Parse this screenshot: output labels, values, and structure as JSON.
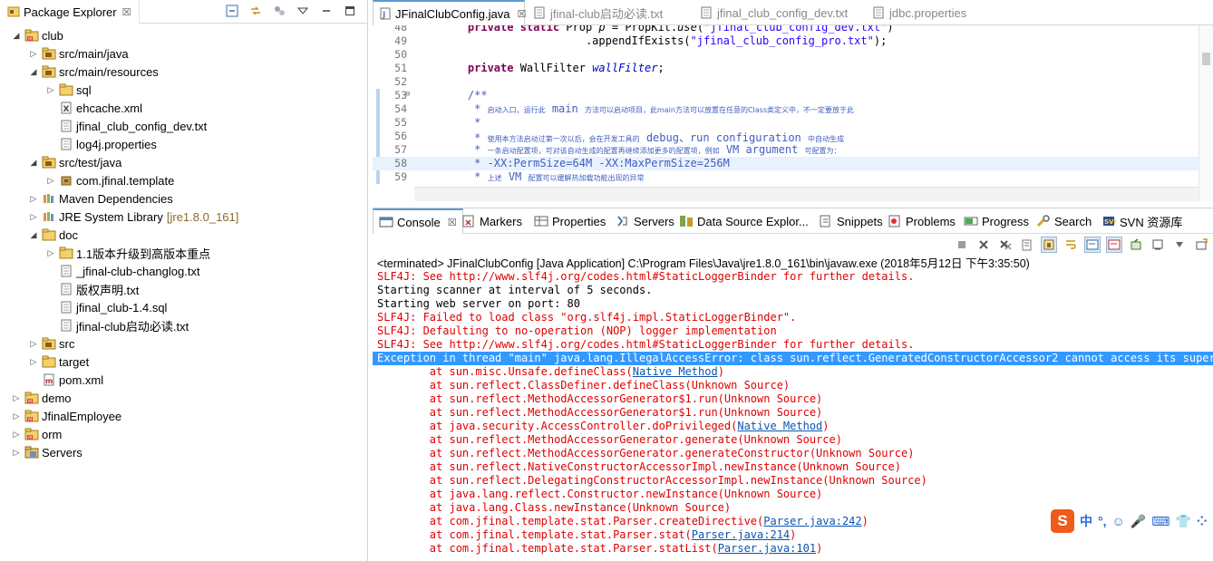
{
  "package_explorer": {
    "tab_label": "Package Explorer",
    "tree": [
      {
        "depth": 0,
        "expanded": true,
        "icon": "project-icon",
        "label": "club"
      },
      {
        "depth": 1,
        "expanded": false,
        "icon": "source-folder-icon",
        "label": "src/main/java"
      },
      {
        "depth": 1,
        "expanded": true,
        "icon": "source-folder-icon",
        "label": "src/main/resources"
      },
      {
        "depth": 2,
        "expanded": false,
        "icon": "folder-icon",
        "label": "sql"
      },
      {
        "depth": 2,
        "leaf": true,
        "icon": "xml-file-icon",
        "label": "ehcache.xml"
      },
      {
        "depth": 2,
        "leaf": true,
        "icon": "text-file-icon",
        "label": "jfinal_club_config_dev.txt"
      },
      {
        "depth": 2,
        "leaf": true,
        "icon": "text-file-icon",
        "label": "log4j.properties"
      },
      {
        "depth": 1,
        "expanded": true,
        "icon": "source-folder-icon",
        "label": "src/test/java"
      },
      {
        "depth": 2,
        "expanded": false,
        "icon": "package-icon",
        "label": "com.jfinal.template"
      },
      {
        "depth": 1,
        "expanded": false,
        "icon": "library-icon",
        "label": "Maven Dependencies"
      },
      {
        "depth": 1,
        "expanded": false,
        "icon": "library-icon",
        "label": "JRE System Library",
        "decoration": "[jre1.8.0_161]"
      },
      {
        "depth": 1,
        "expanded": true,
        "icon": "folder-icon",
        "label": "doc"
      },
      {
        "depth": 2,
        "expanded": false,
        "icon": "folder-icon",
        "label": "1.1版本升级到高版本重点"
      },
      {
        "depth": 2,
        "leaf": true,
        "icon": "text-file-icon",
        "label": "_jfinal-club-changlog.txt"
      },
      {
        "depth": 2,
        "leaf": true,
        "icon": "text-file-icon",
        "label": "版权声明.txt"
      },
      {
        "depth": 2,
        "leaf": true,
        "icon": "text-file-icon",
        "label": "jfinal_club-1.4.sql"
      },
      {
        "depth": 2,
        "leaf": true,
        "icon": "text-file-icon",
        "label": "jfinal-club启动必读.txt"
      },
      {
        "depth": 1,
        "expanded": false,
        "icon": "source-folder-icon",
        "label": "src"
      },
      {
        "depth": 1,
        "expanded": false,
        "icon": "folder-icon",
        "label": "target"
      },
      {
        "depth": 1,
        "leaf": true,
        "icon": "maven-file-icon",
        "label": "pom.xml"
      },
      {
        "depth": 0,
        "expanded": false,
        "icon": "project-icon",
        "label": "demo"
      },
      {
        "depth": 0,
        "expanded": false,
        "icon": "project-icon",
        "label": "JfinalEmployee"
      },
      {
        "depth": 0,
        "expanded": false,
        "icon": "project-icon",
        "label": "orm"
      },
      {
        "depth": 0,
        "expanded": false,
        "icon": "servers-folder-icon",
        "label": "Servers"
      }
    ]
  },
  "editor": {
    "tabs": [
      {
        "label": "JFinalClubConfig.java",
        "active": true,
        "icon": "java-file-icon"
      },
      {
        "label": "jfinal-club启动必读.txt",
        "active": false,
        "icon": "text-file-icon"
      },
      {
        "label": "jfinal_club_config_dev.txt",
        "active": false,
        "icon": "text-file-icon"
      },
      {
        "label": "jdbc.properties",
        "active": false,
        "icon": "text-file-icon"
      }
    ],
    "lines": [
      {
        "n": "48",
        "html": "    <span class=\"kw\">private static</span> Prop <i>p</i> = PropKit.<i>use</i>(<span class=\"str\">\"jfinal_club_config_dev.txt\"</span>)"
      },
      {
        "n": "49",
        "html": "                      .appendIfExists(<span class=\"str\">\"jfinal_club_config_pro.txt\"</span>);"
      },
      {
        "n": "50",
        "html": ""
      },
      {
        "n": "51",
        "html": "    <span class=\"kw\">private</span> WallFilter <span class=\"fld\">wallFilter</span>;"
      },
      {
        "n": "52",
        "html": ""
      },
      {
        "n": "53",
        "fold": true,
        "html": "    <span class=\"jd\">/**</span>"
      },
      {
        "n": "54",
        "html": "     <span class=\"jd\">*</span> <span class=\"jdsm\">启动入口，运行此</span> <span class=\"jd\">main</span> <span class=\"jdsm\">方法可以启动项目，此main方法可以放置在任意的Class类定义中，不一定要放于此</span>"
      },
      {
        "n": "55",
        "html": "     <span class=\"jd\">*</span>"
      },
      {
        "n": "56",
        "html": "     <span class=\"jd\">*</span> <span class=\"jdsm\">使用本方法启动过第一次以后，会在开发工具的</span> <span class=\"jd\">debug、run configuration</span> <span class=\"jdsm\">中自动生成</span>"
      },
      {
        "n": "57",
        "html": "     <span class=\"jd\">*</span> <span class=\"jdsm\">一条启动配置项，可对该自动生成的配置再继续添加更多的配置项，例如</span> <span class=\"jd\">VM argument</span> <span class=\"jdsm\">可配置为：</span>"
      },
      {
        "n": "58",
        "hl": true,
        "html": "     <span class=\"jd\">* -XX:PermSize=64M -XX:MaxPermSize=256M</span>"
      },
      {
        "n": "59",
        "html": "     <span class=\"jd\">*</span> <span class=\"jdsm\">上述</span> <span class=\"jd\">VM</span> <span class=\"jdsm\">配置可以缓解热加载功能出现的异常</span>"
      }
    ]
  },
  "console": {
    "tabs": [
      {
        "label": "Console",
        "icon": "console-icon",
        "active": true
      },
      {
        "label": "Markers",
        "icon": "markers-icon"
      },
      {
        "label": "Properties",
        "icon": "properties-icon"
      },
      {
        "label": "Servers",
        "icon": "servers-icon"
      },
      {
        "label": "Data Source Explor...",
        "icon": "data-source-icon"
      },
      {
        "label": "Snippets",
        "icon": "snippets-icon"
      },
      {
        "label": "Problems",
        "icon": "problems-icon"
      },
      {
        "label": "Progress",
        "icon": "progress-icon"
      },
      {
        "label": "Search",
        "icon": "search-icon"
      },
      {
        "label": "SVN 资源库",
        "icon": "svn-icon"
      }
    ],
    "terminated_line": "<terminated> JFinalClubConfig [Java Application] C:\\Program Files\\Java\\jre1.8.0_161\\bin\\javaw.exe (2018年5月12日 下午3:35:50)",
    "lines": [
      {
        "t": "err",
        "text": "SLF4J: See http://www.slf4j.org/codes.html#StaticLoggerBinder for further details."
      },
      {
        "t": "std",
        "text": "Starting scanner at interval of 5 seconds."
      },
      {
        "t": "std",
        "text": "Starting web server on port: 80"
      },
      {
        "t": "err",
        "text": "SLF4J: Failed to load class \"org.slf4j.impl.StaticLoggerBinder\"."
      },
      {
        "t": "err",
        "text": "SLF4J: Defaulting to no-operation (NOP) logger implementation"
      },
      {
        "t": "err",
        "text": "SLF4J: See http://www.slf4j.org/codes.html#StaticLoggerBinder for further details."
      },
      {
        "t": "sel",
        "text": "Exception in thread \"main\" java.lang.IllegalAccessError: class sun.reflect.GeneratedConstructorAccessor2 cannot access its superclass"
      },
      {
        "t": "err",
        "text": "\tat sun.misc.Unsafe.defineClass(",
        "link": "Native Method",
        "after": ")"
      },
      {
        "t": "err",
        "text": "\tat sun.reflect.ClassDefiner.defineClass(Unknown Source)"
      },
      {
        "t": "err",
        "text": "\tat sun.reflect.MethodAccessorGenerator$1.run(Unknown Source)"
      },
      {
        "t": "err",
        "text": "\tat sun.reflect.MethodAccessorGenerator$1.run(Unknown Source)"
      },
      {
        "t": "err",
        "text": "\tat java.security.AccessController.doPrivileged(",
        "link": "Native Method",
        "after": ")"
      },
      {
        "t": "err",
        "text": "\tat sun.reflect.MethodAccessorGenerator.generate(Unknown Source)"
      },
      {
        "t": "err",
        "text": "\tat sun.reflect.MethodAccessorGenerator.generateConstructor(Unknown Source)"
      },
      {
        "t": "err",
        "text": "\tat sun.reflect.NativeConstructorAccessorImpl.newInstance(Unknown Source)"
      },
      {
        "t": "err",
        "text": "\tat sun.reflect.DelegatingConstructorAccessorImpl.newInstance(Unknown Source)"
      },
      {
        "t": "err",
        "text": "\tat java.lang.reflect.Constructor.newInstance(Unknown Source)"
      },
      {
        "t": "err",
        "text": "\tat java.lang.Class.newInstance(Unknown Source)"
      },
      {
        "t": "err",
        "text": "\tat com.jfinal.template.stat.Parser.createDirective(",
        "link": "Parser.java:242",
        "after": ")"
      },
      {
        "t": "err",
        "text": "\tat com.jfinal.template.stat.Parser.stat(",
        "link": "Parser.java:214",
        "after": ")"
      },
      {
        "t": "err",
        "text": "\tat com.jfinal.template.stat.Parser.statList(",
        "link": "Parser.java:101",
        "after": ")"
      }
    ]
  },
  "ime": {
    "logo": "S",
    "items": [
      "中",
      "°,",
      "☺",
      "🎤",
      "⌨",
      "👕",
      "⁘"
    ]
  },
  "colors": {
    "error_text": "#e00000",
    "selection": "#3399ff",
    "keyword": "#7f0055",
    "string": "#2a00ff",
    "javadoc": "#3f5fbf",
    "link": "#0a54b4"
  }
}
